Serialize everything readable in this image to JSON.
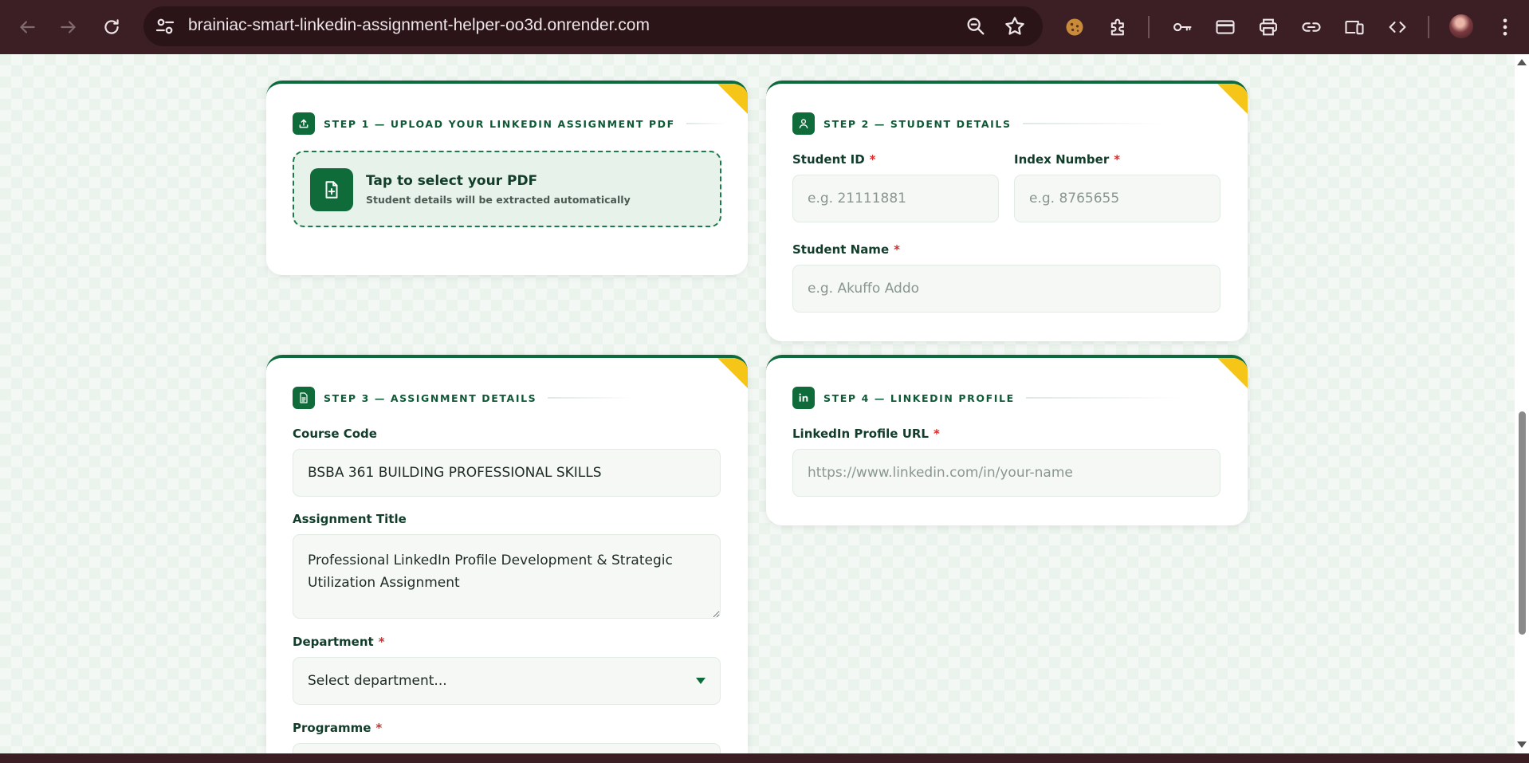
{
  "browser": {
    "url": "brainiac-smart-linkedin-assignment-helper-oo3d.onrender.com"
  },
  "colors": {
    "brand_green": "#0f6b3a",
    "accent_yellow": "#f5c518",
    "required_red": "#d32f2f",
    "chrome_bg": "#3c1f25"
  },
  "step1": {
    "title": "STEP 1 — UPLOAD YOUR LINKEDIN ASSIGNMENT PDF",
    "icon": "upload-icon",
    "upload_title": "Tap to select your PDF",
    "upload_subtitle": "Student details will be extracted automatically"
  },
  "step2": {
    "title": "STEP 2 — STUDENT DETAILS",
    "icon": "user-icon",
    "student_id_label": "Student ID",
    "student_id_placeholder": "e.g. 21111881",
    "index_number_label": "Index Number",
    "index_number_placeholder": "e.g. 8765655",
    "student_name_label": "Student Name",
    "student_name_placeholder": "e.g. Akuffo Addo",
    "required_mark": "*"
  },
  "step3": {
    "title": "STEP 3 — ASSIGNMENT DETAILS",
    "icon": "document-icon",
    "course_code_label": "Course Code",
    "course_code_value": "BSBA 361 BUILDING PROFESSIONAL SKILLS",
    "assignment_title_label": "Assignment Title",
    "assignment_title_value": "Professional LinkedIn Profile Development & Strategic Utilization Assignment",
    "department_label": "Department",
    "department_value": "Select department...",
    "programme_label": "Programme",
    "required_mark": "*"
  },
  "step4": {
    "title": "STEP 4 — LINKEDIN PROFILE",
    "icon": "linkedin-icon",
    "linkedin_url_label": "LinkedIn Profile URL",
    "linkedin_url_placeholder": "https://www.linkedin.com/in/your-name",
    "required_mark": "*"
  }
}
